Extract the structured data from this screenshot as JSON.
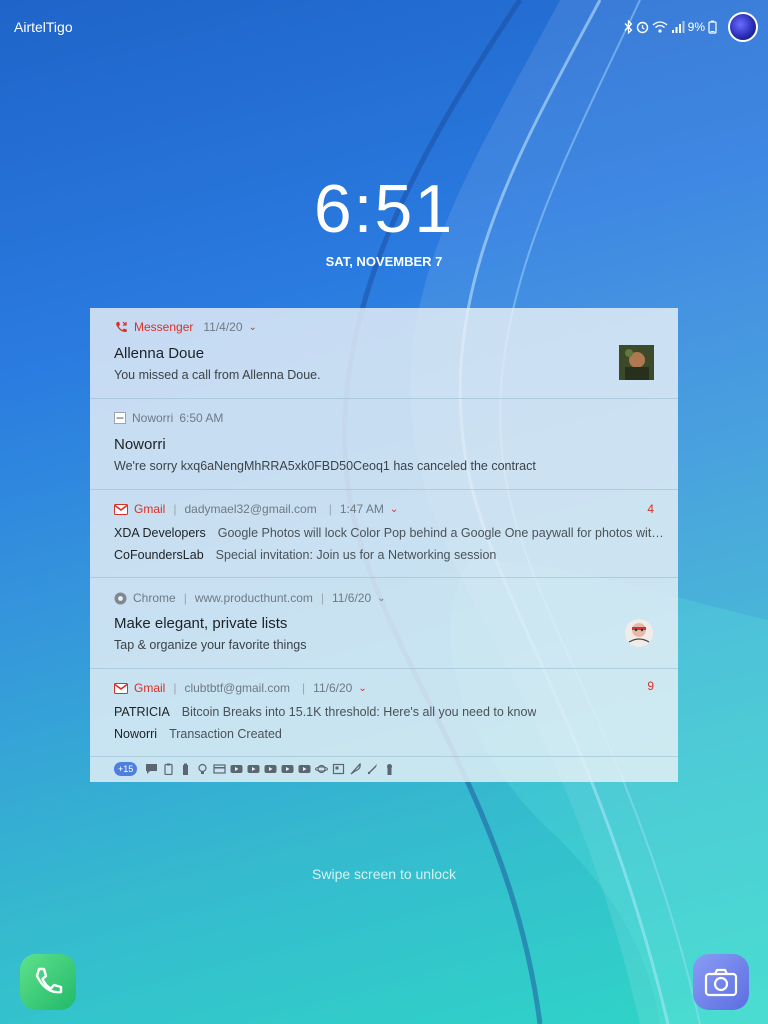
{
  "status": {
    "carrier": "AirtelTigo",
    "battery": "9%",
    "icons": [
      "bluetooth-icon",
      "alarm-icon",
      "wifi-icon",
      "signal-icon",
      "battery-icon"
    ]
  },
  "clock": {
    "time": "6:51",
    "date": "SAT, NOVEMBER 7"
  },
  "notifications": [
    {
      "app": "Messenger",
      "time": "11/4/20",
      "title": "Allenna Doue",
      "text": "You missed a call from Allenna Doue.",
      "icon": "missed-call-icon",
      "accent": "#d93025"
    },
    {
      "app": "Noworri",
      "time": "6:50 AM",
      "title": "Noworri",
      "text": "We're sorry kxq6aNengMhRRA5xk0FBD50Ceoq1 has canceled the contract",
      "icon": "noworri-icon"
    },
    {
      "app": "Gmail",
      "account": "dadymael32@gmail.com",
      "time": "1:47 AM",
      "count": "4",
      "icon": "gmail-icon",
      "accent": "#d93025",
      "messages": [
        {
          "sender": "XDA Developers",
          "subject": "Google Photos will lock Color Pop behind a Google One paywall for photos wit…"
        },
        {
          "sender": "CoFoundersLab",
          "subject": "Special invitation: Join us for a Networking session"
        }
      ]
    },
    {
      "app": "Chrome",
      "site": "www.producthunt.com",
      "time": "11/6/20",
      "title": "Make elegant, private lists",
      "text": "Tap & organize your favorite things",
      "icon": "chrome-icon"
    },
    {
      "app": "Gmail",
      "account": "clubtbtf@gmail.com",
      "time": "11/6/20",
      "count": "9",
      "icon": "gmail-icon",
      "accent": "#d93025",
      "messages": [
        {
          "sender": "PATRICIA",
          "subject": "Bitcoin Breaks into 15.1K threshold: Here's all you need to know"
        },
        {
          "sender": "Noworri",
          "subject": "Transaction Created"
        }
      ]
    }
  ],
  "overflow": {
    "badge": "+15",
    "icons": [
      "message-icon",
      "clipboard-icon",
      "battery-icon",
      "lightbulb-icon",
      "card-icon",
      "youtube-icon",
      "youtube-icon",
      "youtube-icon",
      "youtube-icon",
      "youtube-icon",
      "planet-icon",
      "app-icon",
      "feather-icon",
      "rocket-icon",
      "keyhole-icon"
    ]
  },
  "lockscreen": {
    "swipe_hint": "Swipe screen to unlock",
    "left_shortcut": "phone-icon",
    "right_shortcut": "camera-icon"
  },
  "colors": {
    "accent_red": "#d93025",
    "badge_blue": "#4d7fe0",
    "phone_green": "#22b86a",
    "camera_purple": "#5b6ee0"
  }
}
